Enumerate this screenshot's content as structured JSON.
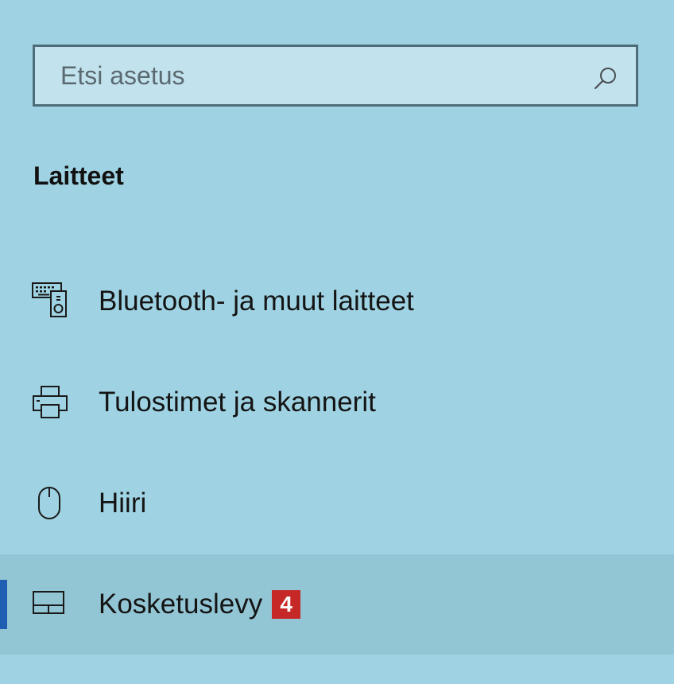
{
  "search": {
    "placeholder": "Etsi asetus",
    "value": "",
    "icon": "search-icon"
  },
  "section": {
    "title": "Laitteet"
  },
  "nav": {
    "items": [
      {
        "label": "Bluetooth- ja muut laitteet",
        "icon": "bluetooth-devices-icon",
        "selected": false
      },
      {
        "label": "Tulostimet ja skannerit",
        "icon": "printer-icon",
        "selected": false
      },
      {
        "label": "Hiiri",
        "icon": "mouse-icon",
        "selected": false
      },
      {
        "label": "Kosketuslevy",
        "icon": "touchpad-icon",
        "selected": true,
        "badge": "4"
      }
    ]
  },
  "colors": {
    "background": "#9fd3e3",
    "selected_background": "#93c6d5",
    "accent": "#1f5eb0",
    "badge": "#c62828"
  }
}
